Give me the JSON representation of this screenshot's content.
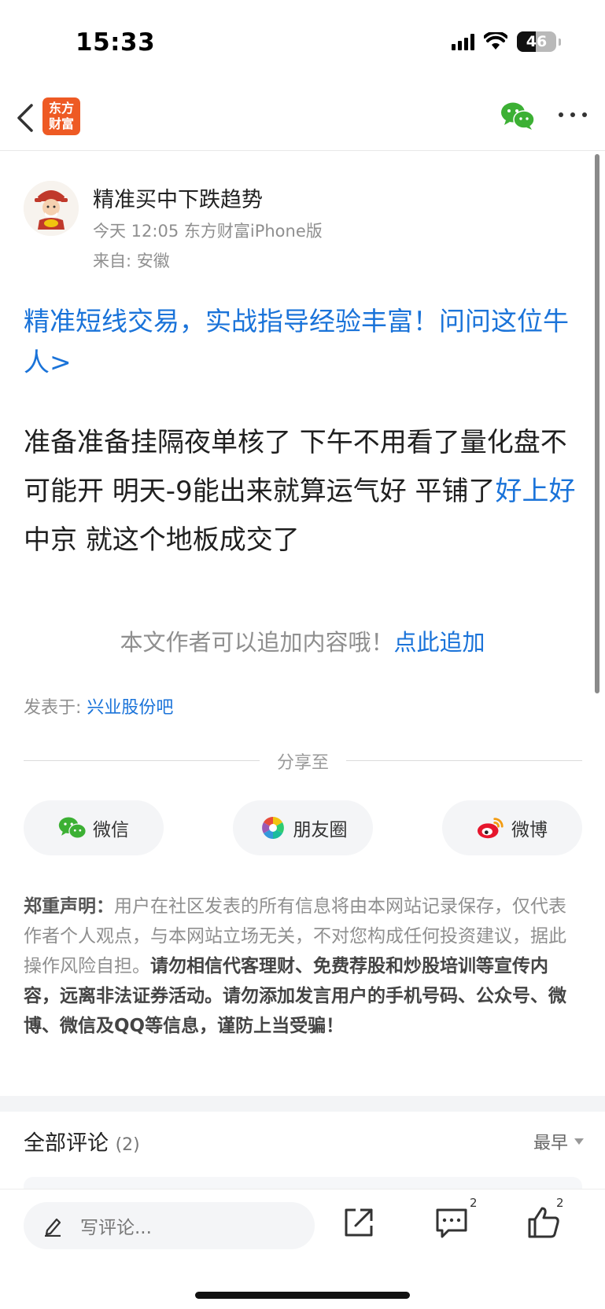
{
  "status_bar": {
    "time": "15:33",
    "battery": "46",
    "icons": [
      "cellular-signal-icon",
      "wifi-icon",
      "battery-icon"
    ]
  },
  "nav": {
    "logo_text_line1": "东方",
    "logo_text_line2": "财富",
    "icons": [
      "back-arrow-icon",
      "wechat-icon",
      "more-icon"
    ],
    "logo_color": "#ee5a24"
  },
  "post": {
    "title": "精准买中下跌趋势",
    "meta": "今天 12:05 东方财富iPhone版",
    "location": "来自: 安徽",
    "promo": "精准短线交易，实战指导经验丰富！问问这位牛人>",
    "body_part1": "准备准备挂隔夜单核了 下午不用看了量化盘不可能开 明天-9能出来就算运气好 平铺了",
    "body_link": "好上好",
    "body_part2": " 中京 就这个地板成交了",
    "append_text": "本文作者可以追加内容哦！",
    "append_link": "点此追加",
    "posted_in_label": "发表于: ",
    "posted_in_bar": "兴业股份吧"
  },
  "share": {
    "label": "分享至",
    "wechat": "微信",
    "moments": "朋友圈",
    "weibo": "微博"
  },
  "disclaimer": {
    "head": "郑重声明：",
    "normal": "用户在社区发表的所有信息将由本网站记录保存，仅代表作者个人观点，与本网站立场无关，不对您构成任何投资建议，据此操作风险自担。",
    "strong": "请勿相信代客理财、免费荐股和炒股培训等宣传内容，远离非法证券活动。请勿添加发言用户的手机号码、公众号、微博、微信及QQ等信息，谨防上当受骗！"
  },
  "comments": {
    "title": "全部评论",
    "count": "(2)",
    "sort": "最早"
  },
  "bottom_bar": {
    "input_placeholder": "写评论...",
    "comment_badge": "2",
    "like_badge": "2"
  },
  "colors": {
    "link_blue": "#1a73d9",
    "wechat_green": "#3cb034",
    "weibo_red": "#e6162d"
  }
}
